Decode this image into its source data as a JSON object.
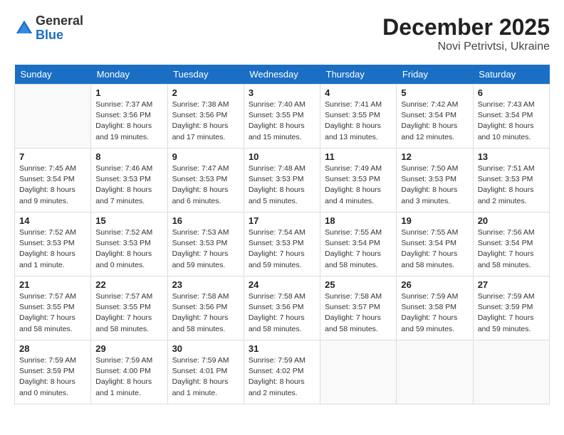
{
  "logo": {
    "general": "General",
    "blue": "Blue"
  },
  "title": "December 2025",
  "location": "Novi Petrivtsi, Ukraine",
  "days_of_week": [
    "Sunday",
    "Monday",
    "Tuesday",
    "Wednesday",
    "Thursday",
    "Friday",
    "Saturday"
  ],
  "weeks": [
    [
      {
        "day": "",
        "info": ""
      },
      {
        "day": "1",
        "info": "Sunrise: 7:37 AM\nSunset: 3:56 PM\nDaylight: 8 hours\nand 19 minutes."
      },
      {
        "day": "2",
        "info": "Sunrise: 7:38 AM\nSunset: 3:56 PM\nDaylight: 8 hours\nand 17 minutes."
      },
      {
        "day": "3",
        "info": "Sunrise: 7:40 AM\nSunset: 3:55 PM\nDaylight: 8 hours\nand 15 minutes."
      },
      {
        "day": "4",
        "info": "Sunrise: 7:41 AM\nSunset: 3:55 PM\nDaylight: 8 hours\nand 13 minutes."
      },
      {
        "day": "5",
        "info": "Sunrise: 7:42 AM\nSunset: 3:54 PM\nDaylight: 8 hours\nand 12 minutes."
      },
      {
        "day": "6",
        "info": "Sunrise: 7:43 AM\nSunset: 3:54 PM\nDaylight: 8 hours\nand 10 minutes."
      }
    ],
    [
      {
        "day": "7",
        "info": "Sunrise: 7:45 AM\nSunset: 3:54 PM\nDaylight: 8 hours\nand 9 minutes."
      },
      {
        "day": "8",
        "info": "Sunrise: 7:46 AM\nSunset: 3:53 PM\nDaylight: 8 hours\nand 7 minutes."
      },
      {
        "day": "9",
        "info": "Sunrise: 7:47 AM\nSunset: 3:53 PM\nDaylight: 8 hours\nand 6 minutes."
      },
      {
        "day": "10",
        "info": "Sunrise: 7:48 AM\nSunset: 3:53 PM\nDaylight: 8 hours\nand 5 minutes."
      },
      {
        "day": "11",
        "info": "Sunrise: 7:49 AM\nSunset: 3:53 PM\nDaylight: 8 hours\nand 4 minutes."
      },
      {
        "day": "12",
        "info": "Sunrise: 7:50 AM\nSunset: 3:53 PM\nDaylight: 8 hours\nand 3 minutes."
      },
      {
        "day": "13",
        "info": "Sunrise: 7:51 AM\nSunset: 3:53 PM\nDaylight: 8 hours\nand 2 minutes."
      }
    ],
    [
      {
        "day": "14",
        "info": "Sunrise: 7:52 AM\nSunset: 3:53 PM\nDaylight: 8 hours\nand 1 minute."
      },
      {
        "day": "15",
        "info": "Sunrise: 7:52 AM\nSunset: 3:53 PM\nDaylight: 8 hours\nand 0 minutes."
      },
      {
        "day": "16",
        "info": "Sunrise: 7:53 AM\nSunset: 3:53 PM\nDaylight: 7 hours\nand 59 minutes."
      },
      {
        "day": "17",
        "info": "Sunrise: 7:54 AM\nSunset: 3:53 PM\nDaylight: 7 hours\nand 59 minutes."
      },
      {
        "day": "18",
        "info": "Sunrise: 7:55 AM\nSunset: 3:54 PM\nDaylight: 7 hours\nand 58 minutes."
      },
      {
        "day": "19",
        "info": "Sunrise: 7:55 AM\nSunset: 3:54 PM\nDaylight: 7 hours\nand 58 minutes."
      },
      {
        "day": "20",
        "info": "Sunrise: 7:56 AM\nSunset: 3:54 PM\nDaylight: 7 hours\nand 58 minutes."
      }
    ],
    [
      {
        "day": "21",
        "info": "Sunrise: 7:57 AM\nSunset: 3:55 PM\nDaylight: 7 hours\nand 58 minutes."
      },
      {
        "day": "22",
        "info": "Sunrise: 7:57 AM\nSunset: 3:55 PM\nDaylight: 7 hours\nand 58 minutes."
      },
      {
        "day": "23",
        "info": "Sunrise: 7:58 AM\nSunset: 3:56 PM\nDaylight: 7 hours\nand 58 minutes."
      },
      {
        "day": "24",
        "info": "Sunrise: 7:58 AM\nSunset: 3:56 PM\nDaylight: 7 hours\nand 58 minutes."
      },
      {
        "day": "25",
        "info": "Sunrise: 7:58 AM\nSunset: 3:57 PM\nDaylight: 7 hours\nand 58 minutes."
      },
      {
        "day": "26",
        "info": "Sunrise: 7:59 AM\nSunset: 3:58 PM\nDaylight: 7 hours\nand 59 minutes."
      },
      {
        "day": "27",
        "info": "Sunrise: 7:59 AM\nSunset: 3:59 PM\nDaylight: 7 hours\nand 59 minutes."
      }
    ],
    [
      {
        "day": "28",
        "info": "Sunrise: 7:59 AM\nSunset: 3:59 PM\nDaylight: 8 hours\nand 0 minutes."
      },
      {
        "day": "29",
        "info": "Sunrise: 7:59 AM\nSunset: 4:00 PM\nDaylight: 8 hours\nand 1 minute."
      },
      {
        "day": "30",
        "info": "Sunrise: 7:59 AM\nSunset: 4:01 PM\nDaylight: 8 hours\nand 1 minute."
      },
      {
        "day": "31",
        "info": "Sunrise: 7:59 AM\nSunset: 4:02 PM\nDaylight: 8 hours\nand 2 minutes."
      },
      {
        "day": "",
        "info": ""
      },
      {
        "day": "",
        "info": ""
      },
      {
        "day": "",
        "info": ""
      }
    ]
  ]
}
